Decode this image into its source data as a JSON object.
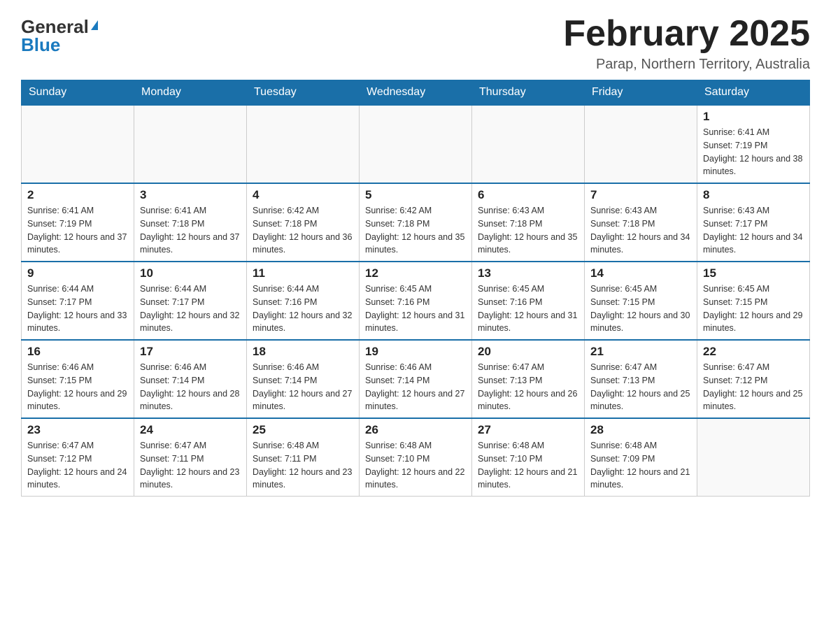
{
  "header": {
    "logo_general": "General",
    "logo_blue": "Blue",
    "month_title": "February 2025",
    "location": "Parap, Northern Territory, Australia"
  },
  "days_of_week": [
    "Sunday",
    "Monday",
    "Tuesday",
    "Wednesday",
    "Thursday",
    "Friday",
    "Saturday"
  ],
  "weeks": [
    [
      {
        "day": null,
        "sunrise": null,
        "sunset": null,
        "daylight": null
      },
      {
        "day": null,
        "sunrise": null,
        "sunset": null,
        "daylight": null
      },
      {
        "day": null,
        "sunrise": null,
        "sunset": null,
        "daylight": null
      },
      {
        "day": null,
        "sunrise": null,
        "sunset": null,
        "daylight": null
      },
      {
        "day": null,
        "sunrise": null,
        "sunset": null,
        "daylight": null
      },
      {
        "day": null,
        "sunrise": null,
        "sunset": null,
        "daylight": null
      },
      {
        "day": "1",
        "sunrise": "Sunrise: 6:41 AM",
        "sunset": "Sunset: 7:19 PM",
        "daylight": "Daylight: 12 hours and 38 minutes."
      }
    ],
    [
      {
        "day": "2",
        "sunrise": "Sunrise: 6:41 AM",
        "sunset": "Sunset: 7:19 PM",
        "daylight": "Daylight: 12 hours and 37 minutes."
      },
      {
        "day": "3",
        "sunrise": "Sunrise: 6:41 AM",
        "sunset": "Sunset: 7:18 PM",
        "daylight": "Daylight: 12 hours and 37 minutes."
      },
      {
        "day": "4",
        "sunrise": "Sunrise: 6:42 AM",
        "sunset": "Sunset: 7:18 PM",
        "daylight": "Daylight: 12 hours and 36 minutes."
      },
      {
        "day": "5",
        "sunrise": "Sunrise: 6:42 AM",
        "sunset": "Sunset: 7:18 PM",
        "daylight": "Daylight: 12 hours and 35 minutes."
      },
      {
        "day": "6",
        "sunrise": "Sunrise: 6:43 AM",
        "sunset": "Sunset: 7:18 PM",
        "daylight": "Daylight: 12 hours and 35 minutes."
      },
      {
        "day": "7",
        "sunrise": "Sunrise: 6:43 AM",
        "sunset": "Sunset: 7:18 PM",
        "daylight": "Daylight: 12 hours and 34 minutes."
      },
      {
        "day": "8",
        "sunrise": "Sunrise: 6:43 AM",
        "sunset": "Sunset: 7:17 PM",
        "daylight": "Daylight: 12 hours and 34 minutes."
      }
    ],
    [
      {
        "day": "9",
        "sunrise": "Sunrise: 6:44 AM",
        "sunset": "Sunset: 7:17 PM",
        "daylight": "Daylight: 12 hours and 33 minutes."
      },
      {
        "day": "10",
        "sunrise": "Sunrise: 6:44 AM",
        "sunset": "Sunset: 7:17 PM",
        "daylight": "Daylight: 12 hours and 32 minutes."
      },
      {
        "day": "11",
        "sunrise": "Sunrise: 6:44 AM",
        "sunset": "Sunset: 7:16 PM",
        "daylight": "Daylight: 12 hours and 32 minutes."
      },
      {
        "day": "12",
        "sunrise": "Sunrise: 6:45 AM",
        "sunset": "Sunset: 7:16 PM",
        "daylight": "Daylight: 12 hours and 31 minutes."
      },
      {
        "day": "13",
        "sunrise": "Sunrise: 6:45 AM",
        "sunset": "Sunset: 7:16 PM",
        "daylight": "Daylight: 12 hours and 31 minutes."
      },
      {
        "day": "14",
        "sunrise": "Sunrise: 6:45 AM",
        "sunset": "Sunset: 7:15 PM",
        "daylight": "Daylight: 12 hours and 30 minutes."
      },
      {
        "day": "15",
        "sunrise": "Sunrise: 6:45 AM",
        "sunset": "Sunset: 7:15 PM",
        "daylight": "Daylight: 12 hours and 29 minutes."
      }
    ],
    [
      {
        "day": "16",
        "sunrise": "Sunrise: 6:46 AM",
        "sunset": "Sunset: 7:15 PM",
        "daylight": "Daylight: 12 hours and 29 minutes."
      },
      {
        "day": "17",
        "sunrise": "Sunrise: 6:46 AM",
        "sunset": "Sunset: 7:14 PM",
        "daylight": "Daylight: 12 hours and 28 minutes."
      },
      {
        "day": "18",
        "sunrise": "Sunrise: 6:46 AM",
        "sunset": "Sunset: 7:14 PM",
        "daylight": "Daylight: 12 hours and 27 minutes."
      },
      {
        "day": "19",
        "sunrise": "Sunrise: 6:46 AM",
        "sunset": "Sunset: 7:14 PM",
        "daylight": "Daylight: 12 hours and 27 minutes."
      },
      {
        "day": "20",
        "sunrise": "Sunrise: 6:47 AM",
        "sunset": "Sunset: 7:13 PM",
        "daylight": "Daylight: 12 hours and 26 minutes."
      },
      {
        "day": "21",
        "sunrise": "Sunrise: 6:47 AM",
        "sunset": "Sunset: 7:13 PM",
        "daylight": "Daylight: 12 hours and 25 minutes."
      },
      {
        "day": "22",
        "sunrise": "Sunrise: 6:47 AM",
        "sunset": "Sunset: 7:12 PM",
        "daylight": "Daylight: 12 hours and 25 minutes."
      }
    ],
    [
      {
        "day": "23",
        "sunrise": "Sunrise: 6:47 AM",
        "sunset": "Sunset: 7:12 PM",
        "daylight": "Daylight: 12 hours and 24 minutes."
      },
      {
        "day": "24",
        "sunrise": "Sunrise: 6:47 AM",
        "sunset": "Sunset: 7:11 PM",
        "daylight": "Daylight: 12 hours and 23 minutes."
      },
      {
        "day": "25",
        "sunrise": "Sunrise: 6:48 AM",
        "sunset": "Sunset: 7:11 PM",
        "daylight": "Daylight: 12 hours and 23 minutes."
      },
      {
        "day": "26",
        "sunrise": "Sunrise: 6:48 AM",
        "sunset": "Sunset: 7:10 PM",
        "daylight": "Daylight: 12 hours and 22 minutes."
      },
      {
        "day": "27",
        "sunrise": "Sunrise: 6:48 AM",
        "sunset": "Sunset: 7:10 PM",
        "daylight": "Daylight: 12 hours and 21 minutes."
      },
      {
        "day": "28",
        "sunrise": "Sunrise: 6:48 AM",
        "sunset": "Sunset: 7:09 PM",
        "daylight": "Daylight: 12 hours and 21 minutes."
      },
      {
        "day": null,
        "sunrise": null,
        "sunset": null,
        "daylight": null
      }
    ]
  ]
}
